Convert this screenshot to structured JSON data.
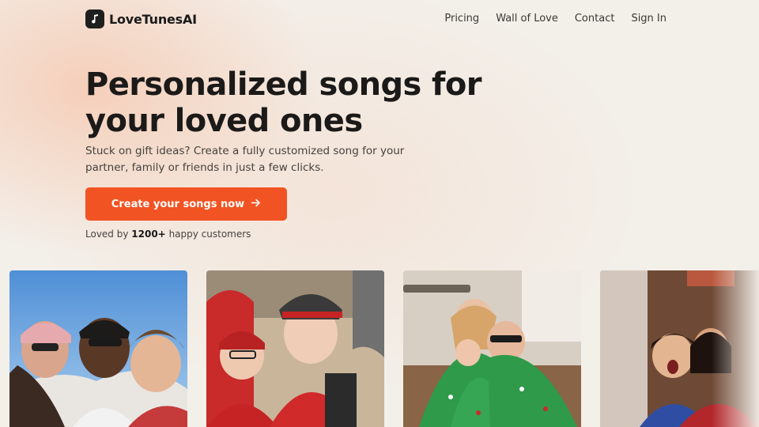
{
  "brand": {
    "name": "LoveTunesAI",
    "icon": "music-note-icon"
  },
  "nav": {
    "items": [
      {
        "label": "Pricing"
      },
      {
        "label": "Wall of Love"
      },
      {
        "label": "Contact"
      },
      {
        "label": "Sign In"
      }
    ]
  },
  "hero": {
    "headline_line1": "Personalized songs for",
    "headline_line2": "your loved ones",
    "subtext": "Stuck on gift ideas? Create a fully customized song for your partner, family or friends in just a few clicks.",
    "cta_label": "Create your songs now",
    "cta_icon": "arrow-right-icon",
    "social_prefix": "Loved by",
    "social_count": "1200+",
    "social_suffix": "happy customers"
  },
  "colors": {
    "accent": "#f25322",
    "background": "#f3efe9",
    "text": "#1b1a19"
  },
  "gallery": {
    "photos": [
      {
        "subject": "family-selfie-outdoors"
      },
      {
        "subject": "friends-in-red-uniforms"
      },
      {
        "subject": "family-in-matching-pajamas"
      },
      {
        "subject": "kids-making-faces"
      }
    ]
  }
}
